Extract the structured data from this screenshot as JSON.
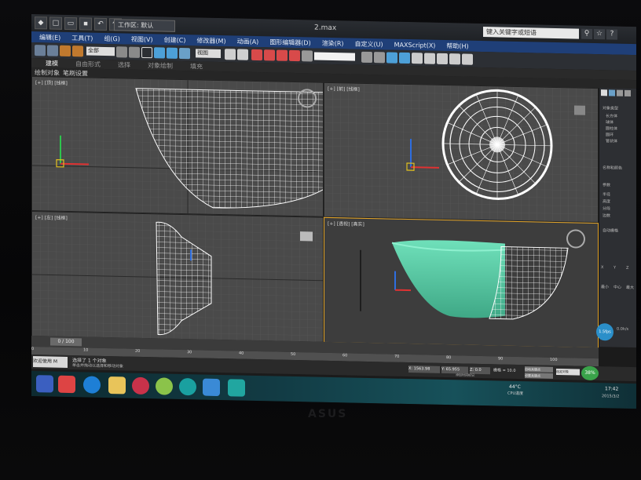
{
  "window": {
    "workspace": "工作区: 默认",
    "file_title": "2.max",
    "help_search_placeholder": "键入关键字或短语"
  },
  "quick_access": [
    "新建",
    "打开",
    "保存",
    "撤消",
    "重做"
  ],
  "menu": [
    "编辑(E)",
    "工具(T)",
    "组(G)",
    "视图(V)",
    "创建(C)",
    "修改器(M)",
    "动画(A)",
    "图形编辑器(D)",
    "渲染(R)",
    "自定义(U)",
    "MAXScript(X)",
    "帮助(H)"
  ],
  "toolbar": {
    "selection_filter": "全部",
    "reference_coord": "视图"
  },
  "ribbon": {
    "tabs": [
      "建模",
      "自由形式",
      "选择",
      "对象绘制",
      "填充"
    ],
    "active_tab": "建模",
    "sub": [
      "绘制对象",
      "笔刷设置"
    ]
  },
  "viewports": {
    "top_left": "[+] [顶] [线框]",
    "top_right": "[+] [前] [线框]",
    "bottom_left": "[+] [左] [线框]",
    "bottom_right": "[+] [透视] [真实]"
  },
  "command_panel": {
    "section1": "对象类型",
    "items": [
      "长方体",
      "球体",
      "圆柱体",
      "圆环",
      "管状体"
    ],
    "section2": "名称和颜色",
    "section3": "参数",
    "radio1": "自动栅格",
    "values": [
      "半径",
      "高度",
      "分段",
      "边数"
    ],
    "buttons": [
      "X",
      "Y",
      "Z",
      "最小",
      "中心",
      "最大"
    ],
    "fps": "1.5fps",
    "viewport_label": "视口",
    "speed": "0.0k/s"
  },
  "timeline": {
    "frame": "0 / 100",
    "ticks": [
      "0",
      "10",
      "20",
      "30",
      "40",
      "50",
      "60",
      "70",
      "80",
      "90",
      "100"
    ]
  },
  "status": {
    "message": "选择了 1 个对象",
    "prompt": "单击并拖动以选择和移动对象",
    "x": "X: 1563.98",
    "y": "Y: 65.955",
    "z": "Z: 0.0",
    "grid": "栅格 = 10.0",
    "autokey": "自动关键点",
    "setkey": "设置关键点",
    "selected": "选定对象",
    "add_time_tag": "添加时间标记",
    "script_label": "欢迎使用 M"
  },
  "taskbar": {
    "temperature": "44°C",
    "temp_label": "CPU温度",
    "time": "17:42",
    "date": "2015/3/2",
    "cpu": "38%"
  },
  "brand": "ASUS",
  "colors": {
    "menubar": "#1f3f78",
    "viewport": "#4a4a4a",
    "wireframe": "#ffffff",
    "bowl": "#5ed0a8",
    "taskbar": "#123b44"
  }
}
